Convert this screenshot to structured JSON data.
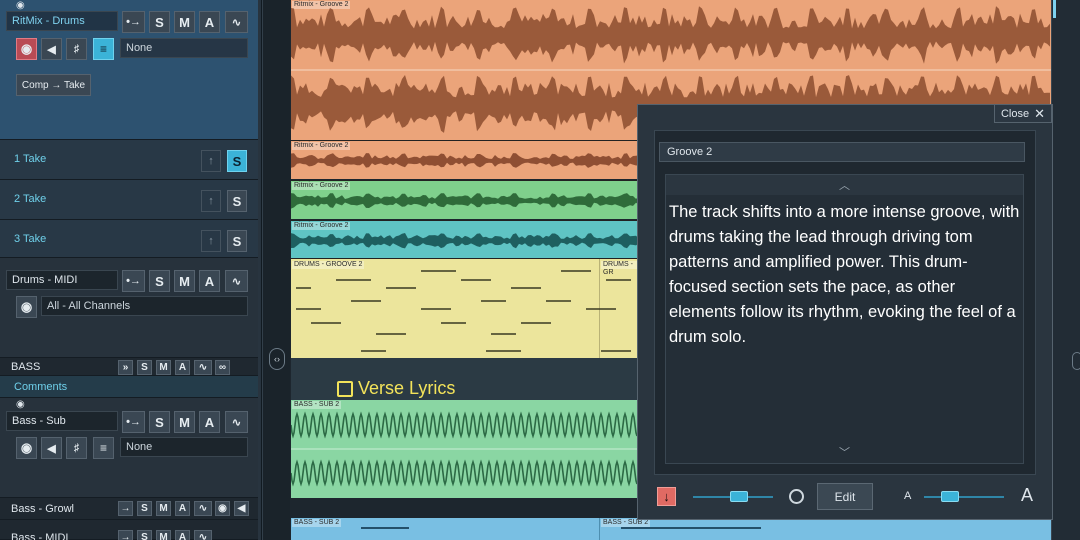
{
  "tracks": {
    "ritmix": {
      "name": "RitMix - Drums",
      "field": "None",
      "comp_button": "Comp → Take"
    },
    "takes": [
      {
        "label": "1 Take",
        "s": "S"
      },
      {
        "label": "2 Take",
        "s": "S"
      },
      {
        "label": "3 Take",
        "s": "S"
      }
    ],
    "drums_midi": {
      "name": "Drums - MIDI",
      "channels": "All - All Channels"
    },
    "bass": {
      "name": "BASS",
      "comments": "Comments"
    },
    "bass_sub": {
      "name": "Bass - Sub",
      "field": "None"
    },
    "bass_growl": {
      "name": "Bass - Growl"
    },
    "bass_midi": {
      "name": "Bass - MIDI"
    },
    "buttons": {
      "s": "S",
      "m": "M",
      "a": "A"
    }
  },
  "clips": {
    "groove2": "Ritmix - Groove 2",
    "take1": "Ritmix - Groove 2",
    "take2": "Ritmix - Groove 2",
    "take3": "Ritmix - Groove 2",
    "drums_groove": "DRUMS - GROOVE 2",
    "drums_groove_b": "DRUMS - GR",
    "bass_sub": "BASS - SUB 2",
    "bass_sub_b": "BASS - SUB 2",
    "bass_sub_c": "BASS - SUB 2"
  },
  "marker": {
    "label": "Verse Lyrics"
  },
  "panel": {
    "close_label": "Close",
    "title": "Groove 2",
    "description": "The track shifts into a more intense groove, with drums taking the lead through driving tom patterns and amplified power. This drum-focused section sets the pace, as other elements follow its rhythm, evoking the feel of a drum solo.",
    "edit_label": "Edit",
    "font_small": "A",
    "font_large": "A"
  },
  "colors": {
    "orange_clip": "#eba47a",
    "green_clip": "#7fd08c",
    "teal_clip": "#5fc4c4",
    "yellow_clip": "#ece59c",
    "bass_clip": "#8ad6a3",
    "accent_cyan": "#3bb3d8",
    "lyrics": "#f3e35a"
  }
}
